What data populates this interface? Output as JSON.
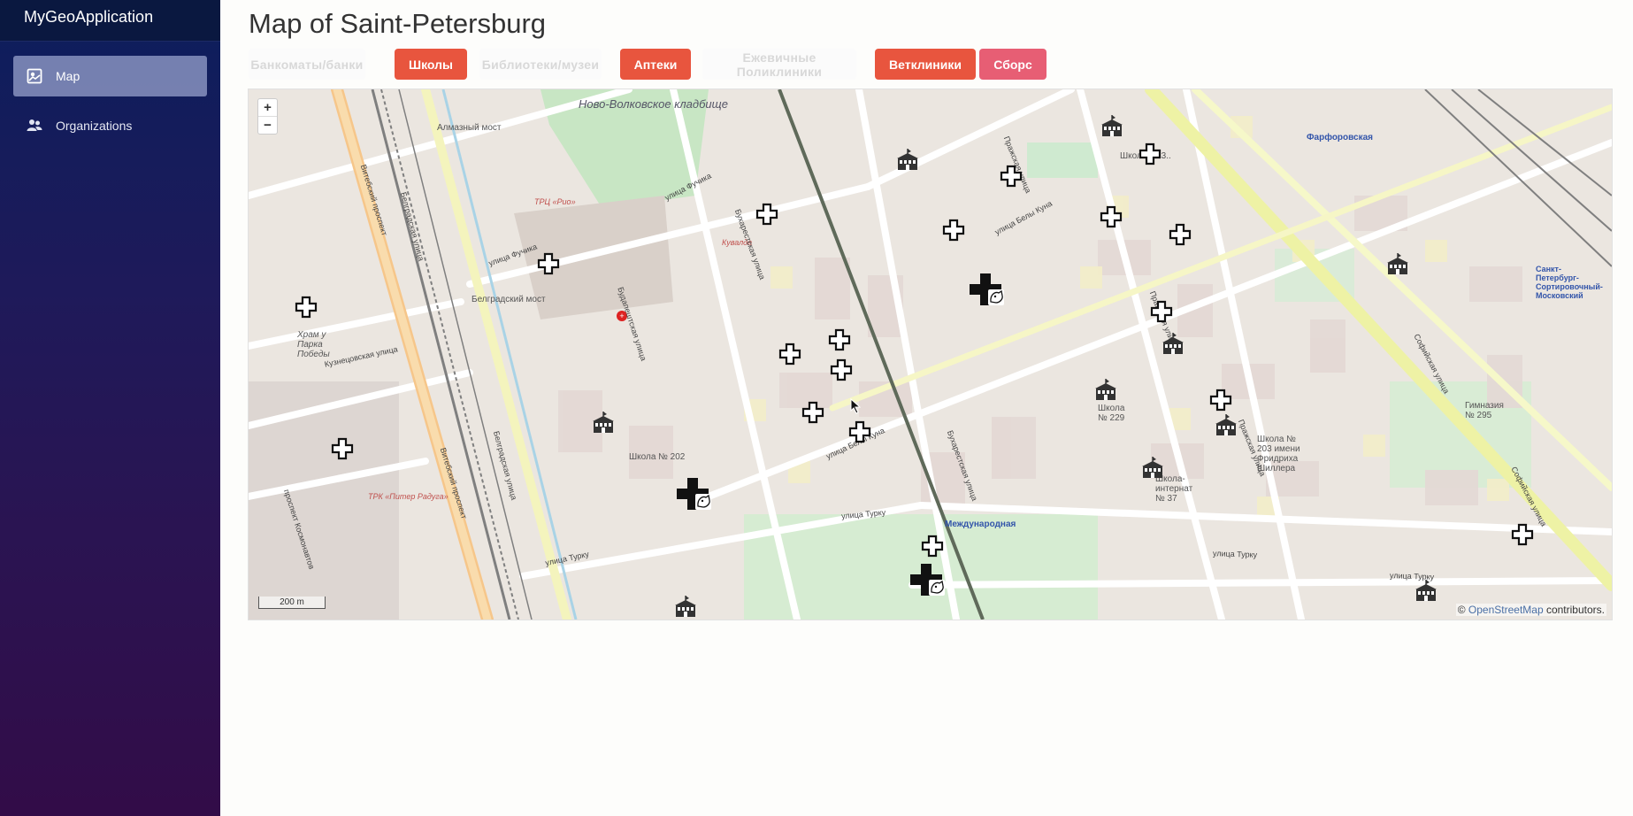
{
  "app": {
    "name": "MyGeoApplication"
  },
  "sidebar": {
    "items": [
      {
        "label": "Map",
        "icon": "map-icon",
        "active": true
      },
      {
        "label": "Organizations",
        "icon": "users-icon",
        "active": false
      }
    ]
  },
  "page": {
    "title": "Map of Saint-Petersburg"
  },
  "filters": {
    "buttons": [
      {
        "label": "Банкоматы/банки",
        "state": "faded"
      },
      {
        "label": "Школы",
        "state": "active"
      },
      {
        "label": "Библиотеки/музеи",
        "state": "faded"
      },
      {
        "label": "Аптеки",
        "state": "active"
      },
      {
        "label": "Ежевичные Поликлиники",
        "state": "faded"
      },
      {
        "label": "Ветклиники",
        "state": "active"
      },
      {
        "label": "Сборс",
        "state": "reset"
      }
    ]
  },
  "map": {
    "zoom_in": "+",
    "zoom_out": "−",
    "scale": "200 m",
    "attribution_prefix": "© ",
    "attribution_link": "OpenStreetMap",
    "attribution_suffix": " contributors.",
    "labels": {
      "cemetery": "Ново-Волковское кладбище",
      "bridge_almaz": "Алмазный мост",
      "bridge_belgrad": "Белградский мост",
      "trc_rio": "ТРЦ «Рио»",
      "kuvalda": "Кувалда",
      "trk_raduga": "ТРК «Питер Радуга»",
      "farforovskaya": "Фарфоровская",
      "mezhdunarodnaya": "Международная",
      "sortirovochnaya": "Санкт-Петербург-Сортировочный-Московский",
      "street_fuchika": "улица Фучика",
      "street_fuchika2": "улица Фучика",
      "street_bela_kuna": "улица Белы Куна",
      "street_bela_kuna2": "улица Белы Куна",
      "street_turku": "улица Турку",
      "street_turku2": "улица Турку",
      "street_turku3": "улица Турку",
      "street_turku4": "улица Турку",
      "street_kuznetsovskaya": "Кузнецовская улица",
      "street_bukharestskaya": "Бухарестская улица",
      "street_bukharestskaya2": "Бухарестская улица",
      "street_belgradskaya": "Белградская улица",
      "street_belgradskaya2": "Белградская улица",
      "street_budapeshtskaya": "Будапештская улица",
      "street_vitebsky": "Витебский проспект",
      "street_vitebsky2": "Витебский проспект",
      "street_prazhskaya": "Пражская улица",
      "street_prazhskaya2": "Пражская улица",
      "street_prazhskaya3": "Пражская улица",
      "street_sofiyskaya": "Софийская улица",
      "street_sofiyskaya2": "Софийская улица",
      "street_kosmonavtov": "проспект Космонавтов",
      "school_202": "Школа № 202",
      "school_203": "Школа № 203 имени Фридриха Шиллера",
      "school_229": "Школа № 229",
      "school_295": "Гимназия № 295",
      "school_internat": "Школа-интернат № 37",
      "school_top": "Школа № 3..",
      "church": "Храм у Парка Победы"
    }
  }
}
